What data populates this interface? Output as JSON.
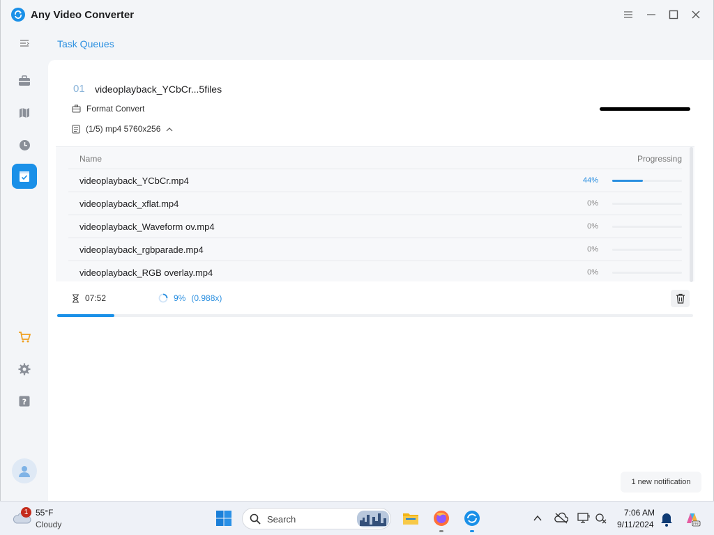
{
  "window": {
    "title": "Any Video Converter",
    "controls": [
      "menu-icon",
      "minimize-icon",
      "maximize-icon",
      "close-icon"
    ]
  },
  "sidebar": {
    "items": [
      {
        "icon": "collapse-menu-icon"
      },
      {
        "icon": "toolbox-icon"
      },
      {
        "icon": "map-icon"
      },
      {
        "icon": "history-clock-icon"
      },
      {
        "icon": "task-queue-icon",
        "active": true
      },
      {
        "icon": "cart-icon"
      },
      {
        "icon": "gear-icon"
      },
      {
        "icon": "help-icon"
      },
      {
        "icon": "user-avatar-icon"
      }
    ],
    "accent": "#1a90e8"
  },
  "page": {
    "title": "Task Queues"
  },
  "task": {
    "index": "01",
    "name": "videoplayback_YCbCr...5files",
    "type": "Format Convert",
    "files_summary": "(1/5) mp4 5760x256",
    "elapsed": "07:52",
    "overall_percent": "9%",
    "speed": "(0.988x)",
    "overall_fraction": 0.09
  },
  "table": {
    "headers": {
      "name": "Name",
      "progress": "Progressing"
    },
    "rows": [
      {
        "name": "videoplayback_YCbCr.mp4",
        "percent": "44%",
        "fraction": 0.44,
        "active": true
      },
      {
        "name": "videoplayback_xflat.mp4",
        "percent": "0%",
        "fraction": 0,
        "active": false
      },
      {
        "name": "videoplayback_Waveform ov.mp4",
        "percent": "0%",
        "fraction": 0,
        "active": false
      },
      {
        "name": "videoplayback_rgbparade.mp4",
        "percent": "0%",
        "fraction": 0,
        "active": false
      },
      {
        "name": "videoplayback_RGB overlay.mp4",
        "percent": "0%",
        "fraction": 0,
        "active": false
      }
    ]
  },
  "notification": {
    "text": "1 new notification"
  },
  "taskbar": {
    "weather": {
      "badge": "1",
      "temp": "55°F",
      "condition": "Cloudy"
    },
    "search_placeholder": "Search",
    "apps": [
      "windows-start-icon",
      "file-explorer-icon",
      "firefox-icon",
      "any-video-converter-icon"
    ],
    "tray": [
      "chevron-up-icon",
      "onedrive-icon",
      "display-icon",
      "network-icon"
    ],
    "clock": {
      "time": "7:06 AM",
      "date": "9/11/2024"
    }
  }
}
